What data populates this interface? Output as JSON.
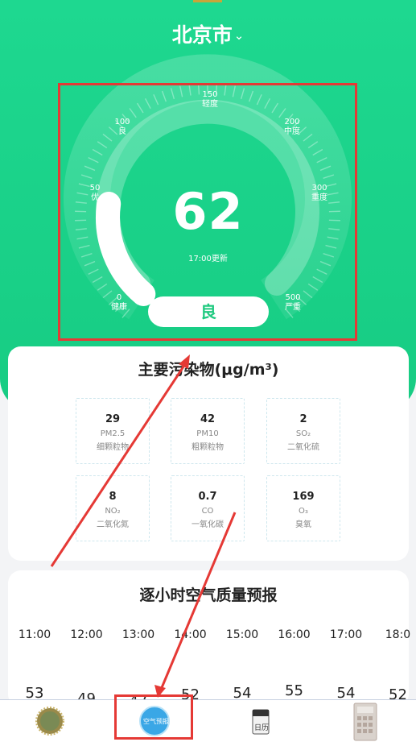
{
  "header": {
    "city": "北京市",
    "chevron_icon": "chevron-down-icon"
  },
  "gauge": {
    "aqi": "62",
    "updated": "17:00更新",
    "level": "良",
    "aqi_value": 62,
    "max": 500,
    "ticks": [
      {
        "value": "0",
        "label": "健康"
      },
      {
        "value": "50",
        "label": "优"
      },
      {
        "value": "100",
        "label": "良"
      },
      {
        "value": "150",
        "label": "轻度"
      },
      {
        "value": "200",
        "label": "中度"
      },
      {
        "value": "300",
        "label": "重度"
      },
      {
        "value": "500",
        "label": "严重"
      }
    ]
  },
  "pollutants": {
    "title": "主要污染物(μg/m³)",
    "items": [
      {
        "value": "29",
        "code": "PM2.5",
        "name": "细颗粒物"
      },
      {
        "value": "42",
        "code": "PM10",
        "name": "粗颗粒物"
      },
      {
        "value": "2",
        "code": "SO₂",
        "name": "二氧化硫"
      },
      {
        "value": "8",
        "code": "NO₂",
        "name": "二氧化氮"
      },
      {
        "value": "0.7",
        "code": "CO",
        "name": "一氧化碳"
      },
      {
        "value": "169",
        "code": "O₃",
        "name": "臭氧"
      }
    ]
  },
  "forecast": {
    "title": "逐小时空气质量预报",
    "hours": [
      "11:00",
      "12:00",
      "13:00",
      "14:00",
      "15:00",
      "16:00",
      "17:00",
      "18:0"
    ],
    "values": [
      "53",
      "49",
      "47",
      "52",
      "54",
      "55",
      "54",
      "52"
    ]
  },
  "tabbar": {
    "tabs": [
      {
        "icon": "weather-badge-icon"
      },
      {
        "icon": "air-quality-icon",
        "label": "空气预报"
      },
      {
        "icon": "calendar-icon",
        "label": "日历"
      },
      {
        "icon": "calculator-icon"
      }
    ]
  },
  "colors": {
    "accent": "#1ed890",
    "annotation": "#e53935",
    "level_text": "#1ec97f"
  }
}
